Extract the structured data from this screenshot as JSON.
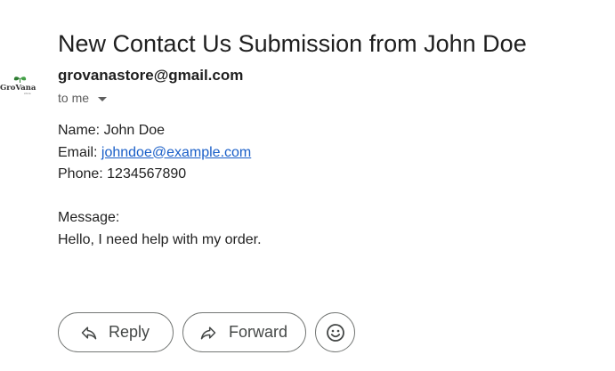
{
  "email": {
    "subject": "New Contact Us Submission from John Doe",
    "sender": {
      "email": "grovanastore@gmail.com",
      "logo_text": "GroVana"
    },
    "recipients_label": "to me",
    "body": {
      "name_line": "Name: John Doe",
      "email_prefix": "Email: ",
      "email_link": "johndoe@example.com",
      "phone_line": "Phone: 1234567890",
      "message_label": "Message:",
      "message_text": "Hello, I need help with my order."
    }
  },
  "actions": {
    "reply_label": "Reply",
    "forward_label": "Forward",
    "reply_icon": "reply-icon",
    "forward_icon": "forward-icon",
    "emoji_icon": "emoji-reaction-icon"
  },
  "colors": {
    "link": "#1a5fc8",
    "button_border": "#747775",
    "logo_green": "#2e7d32"
  }
}
